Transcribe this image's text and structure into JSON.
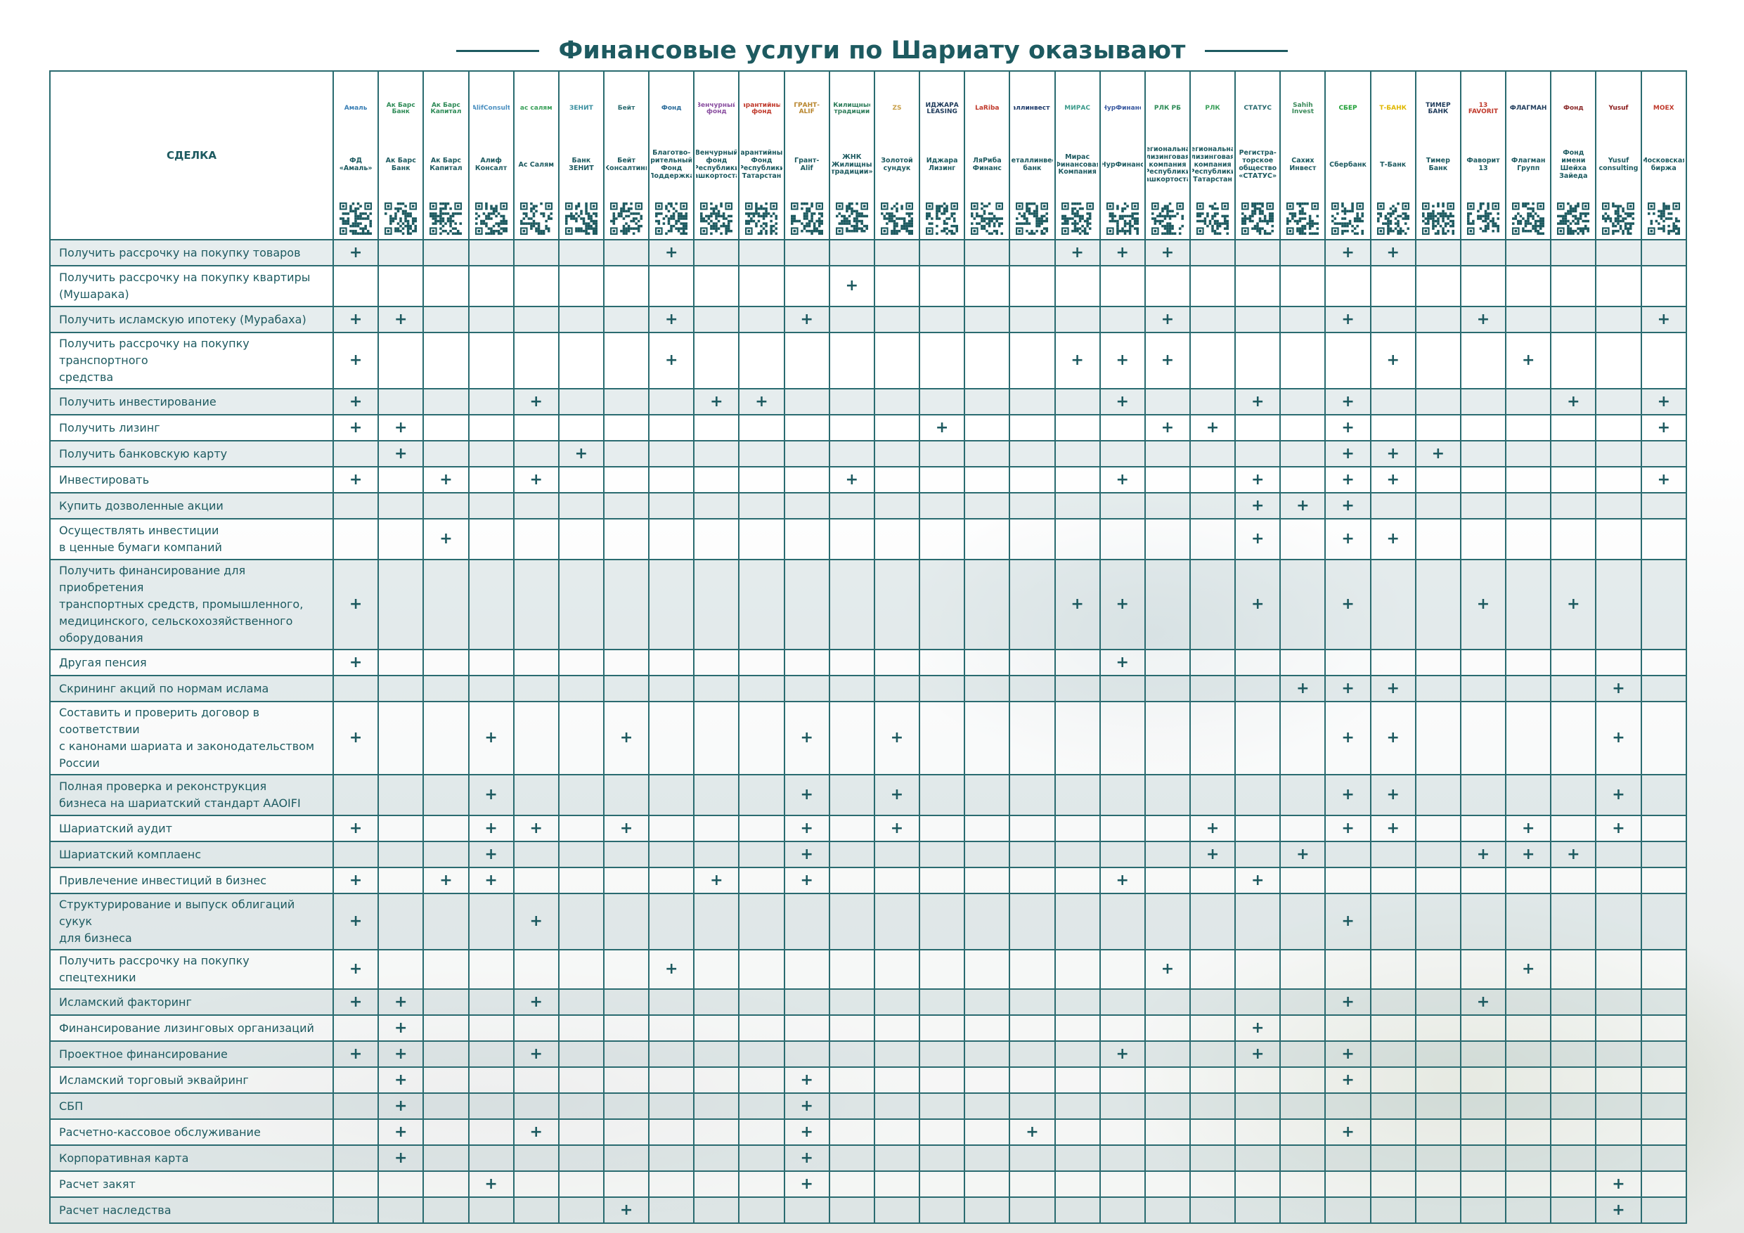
{
  "title": "Финансовые услуги по Шариату оказывают",
  "colors": {
    "accent": "#1d5a60",
    "row_shade": "#d6e2e3"
  },
  "table": {
    "deal_header": "СДЕЛКА",
    "orgs": [
      {
        "name": "ФД\n«Амаль»",
        "logo": "Амаль",
        "logo_color": "#3a7fb5"
      },
      {
        "name": "Ак Барс\nБанк",
        "logo": "Ак Барс Банк",
        "logo_color": "#2e8b57"
      },
      {
        "name": "Ак Барс\nКапитал",
        "logo": "Ак Барс Капитал",
        "logo_color": "#2e8b57"
      },
      {
        "name": "Алиф\nКонсалт",
        "logo": "AlifConsult",
        "logo_color": "#4a8fc0"
      },
      {
        "name": "Ас Салям",
        "logo": "ас салям",
        "logo_color": "#3aa05a"
      },
      {
        "name": "Банк\nЗЕНИТ",
        "logo": "ЗЕНИТ",
        "logo_color": "#3a8fa0"
      },
      {
        "name": "Бейт\nКонсалтинг",
        "logo": "Бейт",
        "logo_color": "#2a6b70"
      },
      {
        "name": "Благотво-\nрительный\nФонд\n«Поддержка»",
        "logo": "Фонд",
        "logo_color": "#2a6b9a"
      },
      {
        "name": "Венчурный\nфонд\nРеспублики\nБашкортостан",
        "logo": "Венчурный фонд",
        "logo_color": "#8a4fa0"
      },
      {
        "name": "Гарантийный\nФонд\nРеспублики\nТатарстан",
        "logo": "Гарантийный фонд",
        "logo_color": "#c0392b"
      },
      {
        "name": "Грант-\nAlif",
        "logo": "ГРАНТ-ALIF",
        "logo_color": "#b8862e"
      },
      {
        "name": "ЖНК\n«Жилищные\nтрадиции»",
        "logo": "Жилищные традиции",
        "logo_color": "#2e7d5a"
      },
      {
        "name": "Золотой\nсундук",
        "logo": "ZS",
        "logo_color": "#c9a04a"
      },
      {
        "name": "Иджара\nЛизинг",
        "logo": "ИДЖАРА LEASING",
        "logo_color": "#1d3a5a"
      },
      {
        "name": "ЛяРиба\nФинанс",
        "logo": "LaRiba",
        "logo_color": "#c0392b"
      },
      {
        "name": "Металлинвест\nбанк",
        "logo": "Металлинвестбанк",
        "logo_color": "#1d3a6a"
      },
      {
        "name": "Мирас\nФинансовая\nКомпания",
        "logo": "МИРАС",
        "logo_color": "#3a9a8a"
      },
      {
        "name": "НурФинанс",
        "logo": "НурФинанс",
        "logo_color": "#3a5aa0"
      },
      {
        "name": "Региональная\nлизинговая\nкомпания\nРеспублики\nБашкортостан",
        "logo": "РЛК РБ",
        "logo_color": "#2e8b57"
      },
      {
        "name": "Региональная\nлизинговая\nкомпания\nРеспублики\nТатарстан",
        "logo": "РЛК",
        "logo_color": "#3aa05a"
      },
      {
        "name": "Регистра-\nторское\nобщество\n«СТАТУС»",
        "logo": "СТАТУС",
        "logo_color": "#2a6b70"
      },
      {
        "name": "Сахих\nИнвест",
        "logo": "Sahih Invest",
        "logo_color": "#3a8a5a"
      },
      {
        "name": "Сбербанк",
        "logo": "СБЕР",
        "logo_color": "#21a038"
      },
      {
        "name": "Т-Банк",
        "logo": "Т-БАНК",
        "logo_color": "#e0b800"
      },
      {
        "name": "Тимер\nБанк",
        "logo": "ТИМЕР БАНК",
        "logo_color": "#1d3a5a"
      },
      {
        "name": "Фаворит\n13",
        "logo": "13 FAVORIT",
        "logo_color": "#c0392b"
      },
      {
        "name": "Флагман\nГрупп",
        "logo": "ФЛАГМАН",
        "logo_color": "#1d3a5a"
      },
      {
        "name": "Фонд\nимени\nШейха\nЗайеда",
        "logo": "Фонд",
        "logo_color": "#8a2a2a"
      },
      {
        "name": "Yusuf\nconsulting",
        "logo": "Yusuf",
        "logo_color": "#8a1a1a"
      },
      {
        "name": "Московская\nбиржа",
        "logo": "MOEX",
        "logo_color": "#c0392b"
      }
    ],
    "rows": [
      {
        "label": "Получить рассрочку на покупку товаров",
        "marks": [
          0,
          7,
          16,
          17,
          18,
          22,
          23
        ]
      },
      {
        "label": "Получить рассрочку на покупку квартиры\n(Мушарака)",
        "marks": [
          11
        ]
      },
      {
        "label": "Получить исламскую ипотеку (Мурабаха)",
        "marks": [
          0,
          1,
          7,
          10,
          18,
          22,
          25,
          29
        ]
      },
      {
        "label": "Получить рассрочку на покупку транспортного\nсредства",
        "marks": [
          0,
          7,
          16,
          17,
          18,
          23,
          26
        ]
      },
      {
        "label": "Получить инвестирование",
        "marks": [
          0,
          4,
          8,
          9,
          17,
          20,
          22,
          27,
          29
        ]
      },
      {
        "label": "Получить лизинг",
        "marks": [
          0,
          1,
          13,
          18,
          19,
          22,
          29
        ]
      },
      {
        "label": "Получить банковскую карту",
        "marks": [
          1,
          5,
          22,
          23,
          24
        ]
      },
      {
        "label": "Инвестировать",
        "marks": [
          0,
          2,
          4,
          11,
          17,
          20,
          22,
          23,
          29
        ]
      },
      {
        "label": "Купить дозволенные акции",
        "marks": [
          20,
          21,
          22
        ]
      },
      {
        "label": "Осуществлять инвестиции\nв  ценные бумаги компаний",
        "marks": [
          2,
          20,
          22,
          23
        ]
      },
      {
        "label": "Получить финансирование для приобретения\nтранспортных средств, промышленного,\nмедицинского, сельскохозяйственного\nоборудования",
        "marks": [
          0,
          16,
          17,
          20,
          22,
          25,
          27
        ]
      },
      {
        "label": "Другая пенсия",
        "marks": [
          0,
          17
        ]
      },
      {
        "label": "Скрининг акций по нормам ислама",
        "marks": [
          21,
          22,
          23,
          28
        ]
      },
      {
        "label": "Составить и проверить договор в соответствии\nс канонами шариата и законодательством России",
        "marks": [
          0,
          3,
          6,
          10,
          12,
          22,
          23,
          28
        ]
      },
      {
        "label": "Полная проверка и реконструкция\nбизнеса на шариатский стандарт AAOIFI",
        "marks": [
          3,
          10,
          12,
          22,
          23,
          28
        ]
      },
      {
        "label": "Шариатский аудит",
        "marks": [
          0,
          3,
          4,
          6,
          10,
          12,
          19,
          22,
          23,
          26,
          28
        ]
      },
      {
        "label": "Шариатский комплаенс",
        "marks": [
          3,
          10,
          19,
          21,
          25,
          26,
          27
        ]
      },
      {
        "label": "Привлечение инвестиций в бизнес",
        "marks": [
          0,
          2,
          3,
          8,
          10,
          17,
          20
        ]
      },
      {
        "label": "Структурирование и выпуск облигаций сукук\nдля бизнеса",
        "marks": [
          0,
          4,
          22
        ]
      },
      {
        "label": "Получить рассрочку на покупку спецтехники",
        "marks": [
          0,
          7,
          18,
          26
        ]
      },
      {
        "label": "Исламский факторинг",
        "marks": [
          0,
          1,
          4,
          22,
          25
        ]
      },
      {
        "label": "Финансирование лизинговых организаций",
        "marks": [
          1,
          20
        ]
      },
      {
        "label": "Проектное финансирование",
        "marks": [
          0,
          1,
          4,
          17,
          20,
          22
        ]
      },
      {
        "label": "Исламский торговый эквайринг",
        "marks": [
          1,
          10,
          22
        ]
      },
      {
        "label": "СБП",
        "marks": [
          1,
          10
        ]
      },
      {
        "label": "Расчетно-кассовое обслуживание",
        "marks": [
          1,
          4,
          10,
          15,
          22
        ]
      },
      {
        "label": "Корпоративная карта",
        "marks": [
          1,
          10
        ]
      },
      {
        "label": "Расчет закят",
        "marks": [
          3,
          10,
          28
        ]
      },
      {
        "label": "Расчет наследства",
        "marks": [
          6,
          28
        ]
      }
    ],
    "plus": "+"
  }
}
